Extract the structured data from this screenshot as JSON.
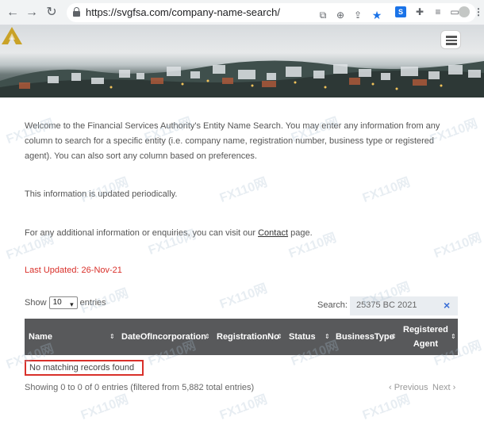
{
  "browser": {
    "url": "https://svgfsa.com/company-name-search/",
    "back_icon": "back-arrow-icon",
    "forward_icon": "forward-arrow-icon",
    "reload_icon": "reload-icon",
    "extension_box_label": "S"
  },
  "banner": {
    "logo_icon": "fsa-logo-icon",
    "menu_icon": "hamburger-menu-icon"
  },
  "intro": {
    "line1": "Welcome to the Financial Services Authority's Entity Name Search. You may enter any information from any",
    "line2": "column to search for a specific entity (i.e. company name, registration number, business type or registered",
    "line3": "agent). You can also sort any column based on preferences.",
    "updated_note": "This information is updated periodically.",
    "contact_prefix": "For any additional information or enquiries, you can visit our",
    "contact_link": "Contact",
    "contact_suffix": "page."
  },
  "last_updated": "Last Updated:  26-Nov-21",
  "table_controls": {
    "show_label": "Show",
    "entries_value": "10",
    "entries_label": "entries",
    "search_label": "Search:",
    "search_value": "25375 BC 2021",
    "clear_label": "×"
  },
  "table": {
    "columns": [
      "Name",
      "DateOfIncorporation",
      "RegistrationNo",
      "Status",
      "BusinessType",
      "Registered",
      "Agent"
    ],
    "sort_icon": "⇕",
    "empty_message": "No matching records found",
    "info": "Showing 0 to 0 of 0 entries (filtered from 5,882 total entries)",
    "previous_label": "‹ Previous",
    "next_label": "Next ›"
  },
  "colors": {
    "header_bg": "#58595b",
    "alert_red": "#d9302a",
    "search_bg": "#e9edf1"
  },
  "watermark_text": "FX110网"
}
